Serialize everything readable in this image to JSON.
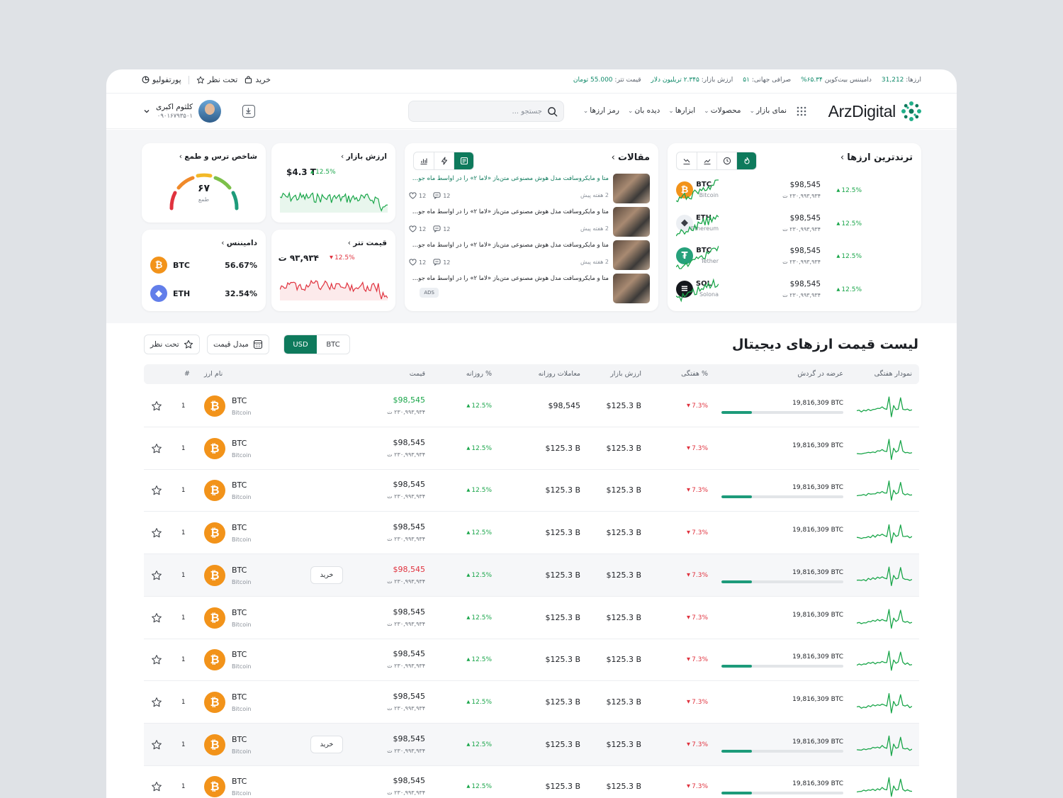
{
  "topbar": {
    "stats": [
      {
        "label": "ارزها:",
        "value": "31,212"
      },
      {
        "label": "دامیننس بیت‌کوین",
        "value": "۶۵.۳۴%"
      },
      {
        "label": "صرافی جهانی:",
        "value": "۵۱"
      },
      {
        "label": "ارزش بازار:",
        "value": "۲.۳۴۵ تریلیون دلار"
      },
      {
        "label": "قیمت تتر:",
        "value": "55.000 تومان"
      }
    ],
    "portfolio": "پورتفولیو",
    "watch": "تحت نظر",
    "buy": "خرید"
  },
  "header": {
    "logo": "ArzDigital",
    "nav": [
      "رمز ارزها",
      "دیده بان",
      "ابزارها",
      "محصولات",
      "نمای بازار"
    ],
    "search_placeholder": "جستجو ...",
    "user_name": "کلثوم اکبری",
    "user_phone": "۰۹۰۱۶۷۹۳۵۰۱"
  },
  "trending": {
    "title": "ترندترین ارزها",
    "items": [
      {
        "sym": "BTC",
        "name": "Bitcoin",
        "icon": "bitcoin-icon",
        "price": "$98,545",
        "toman": "۲۳۰,۹۹۳,۹۳۴ ت",
        "change": "12.5%"
      },
      {
        "sym": "ETH",
        "name": "Ethereum",
        "icon": "ethereum-icon",
        "price": "$98,545",
        "toman": "۲۳۰,۹۹۳,۹۳۴ ت",
        "change": "12.5%"
      },
      {
        "sym": "BTC",
        "name": "Tether",
        "icon": "tether-icon",
        "price": "$98,545",
        "toman": "۲۳۰,۹۹۳,۹۳۴ ت",
        "change": "12.5%"
      },
      {
        "sym": "SOL",
        "name": "Solona",
        "icon": "solana-icon",
        "price": "$98,545",
        "toman": "۲۳۰,۹۹۳,۹۳۴ ت",
        "change": "12.5%"
      }
    ]
  },
  "articles": {
    "title": "مقالات",
    "items": [
      {
        "title": "متا و مایکروسافت مدل هوش مصنوعی متن‌باز «لاما ۲» را در اواسط ماه جولای منتشر کردند",
        "time": "2 هفته پیش",
        "likes": "12",
        "comments": "12"
      },
      {
        "title": "متا و مایکروسافت مدل هوش مصنوعی متن‌باز «لاما ۲» را در اواسط ماه جولای منتشر کردند",
        "time": "2 هفته پیش",
        "likes": "12",
        "comments": "12"
      },
      {
        "title": "متا و مایکروسافت مدل هوش مصنوعی متن‌باز «لاما ۲» را در اواسط ماه جولای منتشر کردند",
        "time": "2 هفته پیش",
        "likes": "12",
        "comments": "12"
      },
      {
        "title": "متا و مایکروسافت مدل هوش مصنوعی متن‌باز «لاما ۲» را در اواسط ماه جولای منتشر کردند",
        "badge": "ADS"
      }
    ]
  },
  "market_value": {
    "title": "ارزش بازار",
    "value": "$4.3 T",
    "change": "12.5%"
  },
  "tether_price": {
    "title": "قیمت تتر",
    "value": "۹۳,۹۳۴ ت",
    "change": "12.5%"
  },
  "fear_greed": {
    "title": "شاخص ترس و طمع",
    "value": "۶۷",
    "label": "طمع",
    "level": 0.67
  },
  "dominance": {
    "title": "دامیننس",
    "items": [
      {
        "sym": "BTC",
        "value": "56.67%"
      },
      {
        "sym": "ETH",
        "value": "32.54%"
      }
    ]
  },
  "list": {
    "title": "لیست قیمت ارزهای دیجیتال",
    "segments": [
      "BTC",
      "USD"
    ],
    "active_segment": "USD",
    "converter": "مبدل قیمت",
    "watch": "تحت نظر",
    "columns": {
      "spark": "نمودار هفتگی",
      "supply": "عرضه در گردش",
      "week": "% هفتگی",
      "mcap": "ارزش بازار",
      "volume": "معاملات روزانه",
      "day": "% روزانه",
      "price": "قیمت",
      "name": "نام ارز",
      "rank": "#"
    },
    "buy_label": "خرید",
    "rows": [
      {
        "rank": "1",
        "sym": "BTC",
        "name": "Bitcoin",
        "price": "$98,545",
        "toman": "۲۳۰,۹۹۳,۹۳۴ ت",
        "day": "12.5%",
        "volume": "$98,545",
        "mcap": "$125.3 B",
        "week": "7.3%",
        "supply": "19,816,309 BTC",
        "supply_ratio": 0.25,
        "price_color": "green",
        "highlight": false
      },
      {
        "rank": "1",
        "sym": "BTC",
        "name": "Bitcoin",
        "price": "$98,545",
        "toman": "۲۳۰,۹۹۳,۹۳۴ ت",
        "day": "12.5%",
        "volume": "$125.3 B",
        "mcap": "$125.3 B",
        "week": "7.3%",
        "supply": "19,816,309 BTC",
        "supply_ratio": 0,
        "price_color": "",
        "highlight": false
      },
      {
        "rank": "1",
        "sym": "BTC",
        "name": "Bitcoin",
        "price": "$98,545",
        "toman": "۲۳۰,۹۹۳,۹۳۴ ت",
        "day": "12.5%",
        "volume": "$125.3 B",
        "mcap": "$125.3 B",
        "week": "7.3%",
        "supply": "19,816,309 BTC",
        "supply_ratio": 0.25,
        "price_color": "",
        "highlight": false
      },
      {
        "rank": "1",
        "sym": "BTC",
        "name": "Bitcoin",
        "price": "$98,545",
        "toman": "۲۳۰,۹۹۳,۹۳۴ ت",
        "day": "12.5%",
        "volume": "$125.3 B",
        "mcap": "$125.3 B",
        "week": "7.3%",
        "supply": "19,816,309 BTC",
        "supply_ratio": 0,
        "price_color": "",
        "highlight": false
      },
      {
        "rank": "1",
        "sym": "BTC",
        "name": "Bitcoin",
        "price": "$98,545",
        "toman": "۲۳۰,۹۹۳,۹۳۴ ت",
        "day": "12.5%",
        "volume": "$125.3 B",
        "mcap": "$125.3 B",
        "week": "7.3%",
        "supply": "19,816,309 BTC",
        "supply_ratio": 0.25,
        "price_color": "red",
        "highlight": true
      },
      {
        "rank": "1",
        "sym": "BTC",
        "name": "Bitcoin",
        "price": "$98,545",
        "toman": "۲۳۰,۹۹۳,۹۳۴ ت",
        "day": "12.5%",
        "volume": "$125.3 B",
        "mcap": "$125.3 B",
        "week": "7.3%",
        "supply": "19,816,309 BTC",
        "supply_ratio": 0,
        "price_color": "",
        "highlight": false
      },
      {
        "rank": "1",
        "sym": "BTC",
        "name": "Bitcoin",
        "price": "$98,545",
        "toman": "۲۳۰,۹۹۳,۹۳۴ ت",
        "day": "12.5%",
        "volume": "$125.3 B",
        "mcap": "$125.3 B",
        "week": "7.3%",
        "supply": "19,816,309 BTC",
        "supply_ratio": 0.25,
        "price_color": "",
        "highlight": false
      },
      {
        "rank": "1",
        "sym": "BTC",
        "name": "Bitcoin",
        "price": "$98,545",
        "toman": "۲۳۰,۹۹۳,۹۳۴ ت",
        "day": "12.5%",
        "volume": "$125.3 B",
        "mcap": "$125.3 B",
        "week": "7.3%",
        "supply": "19,816,309 BTC",
        "supply_ratio": 0,
        "price_color": "",
        "highlight": false
      },
      {
        "rank": "1",
        "sym": "BTC",
        "name": "Bitcoin",
        "price": "$98,545",
        "toman": "۲۳۰,۹۹۳,۹۳۴ ت",
        "day": "12.5%",
        "volume": "$125.3 B",
        "mcap": "$125.3 B",
        "week": "7.3%",
        "supply": "19,816,309 BTC",
        "supply_ratio": 0.25,
        "price_color": "",
        "highlight": true
      },
      {
        "rank": "1",
        "sym": "BTC",
        "name": "Bitcoin",
        "price": "$98,545",
        "toman": "۲۳۰,۹۹۳,۹۳۴ ت",
        "day": "12.5%",
        "volume": "$125.3 B",
        "mcap": "$125.3 B",
        "week": "7.3%",
        "supply": "19,816,309 BTC",
        "supply_ratio": 0.25,
        "price_color": "",
        "highlight": false
      }
    ]
  },
  "colors": {
    "brand": "#0e7a5c",
    "up": "#1aa64a",
    "down": "#e0323e"
  }
}
